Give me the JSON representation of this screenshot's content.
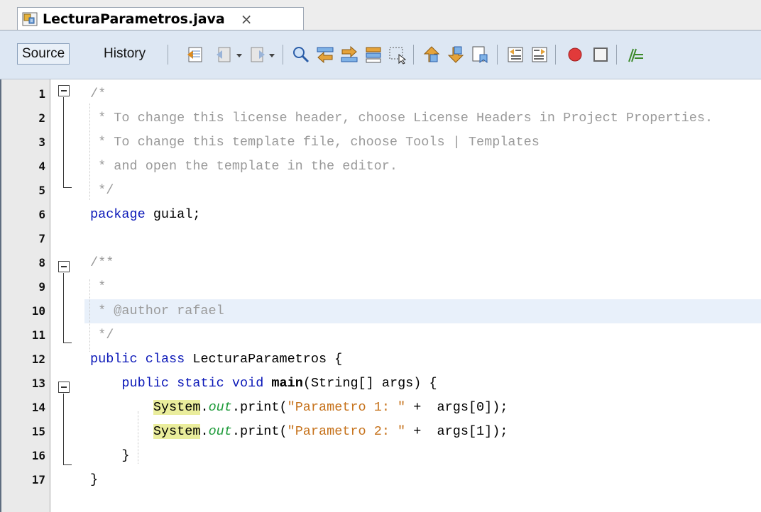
{
  "tab": {
    "title": "LecturaParametros.java",
    "close_glyph": "×"
  },
  "toolbar": {
    "source_label": "Source",
    "history_label": "History",
    "icons": [
      "last-edit-icon",
      "back-icon",
      "forward-icon",
      "find-selection-icon",
      "find-previous-icon",
      "find-next-icon",
      "toggle-highlight-icon",
      "toggle-rectangular-selection-icon",
      "previous-bookmark-icon",
      "next-bookmark-icon",
      "toggle-bookmark-icon",
      "shift-left-icon",
      "shift-right-icon",
      "start-macro-icon",
      "stop-macro-icon",
      "comment-icon"
    ]
  },
  "editor": {
    "lines": [
      {
        "n": "1",
        "tokens": [
          {
            "t": "/*",
            "c": "cm"
          }
        ]
      },
      {
        "n": "2",
        "tokens": [
          {
            "t": " * To change this license header, choose License Headers in Project Properties.",
            "c": "cm"
          }
        ]
      },
      {
        "n": "3",
        "tokens": [
          {
            "t": " * To change this template file, choose Tools | Templates",
            "c": "cm"
          }
        ]
      },
      {
        "n": "4",
        "tokens": [
          {
            "t": " * and open the template in the editor.",
            "c": "cm"
          }
        ]
      },
      {
        "n": "5",
        "tokens": [
          {
            "t": " */",
            "c": "cm"
          }
        ]
      },
      {
        "n": "6",
        "tokens": [
          {
            "t": "package",
            "c": "kw"
          },
          {
            "t": " guial;",
            "c": ""
          }
        ]
      },
      {
        "n": "7",
        "tokens": []
      },
      {
        "n": "8",
        "tokens": [
          {
            "t": "/**",
            "c": "cm"
          }
        ]
      },
      {
        "n": "9",
        "tokens": [
          {
            "t": " *",
            "c": "cm"
          }
        ]
      },
      {
        "n": "10",
        "tokens": [
          {
            "t": " * @author rafael",
            "c": "cm"
          }
        ],
        "highlight": true
      },
      {
        "n": "11",
        "tokens": [
          {
            "t": " */",
            "c": "cm"
          }
        ]
      },
      {
        "n": "12",
        "tokens": [
          {
            "t": "public",
            "c": "kw"
          },
          {
            "t": " ",
            "c": ""
          },
          {
            "t": "class",
            "c": "kw"
          },
          {
            "t": " LecturaParametros {",
            "c": ""
          }
        ]
      },
      {
        "n": "13",
        "tokens": [
          {
            "t": "    ",
            "c": ""
          },
          {
            "t": "public",
            "c": "kw"
          },
          {
            "t": " ",
            "c": ""
          },
          {
            "t": "static",
            "c": "kw"
          },
          {
            "t": " ",
            "c": ""
          },
          {
            "t": "void",
            "c": "kw"
          },
          {
            "t": " ",
            "c": ""
          },
          {
            "t": "main",
            "c": "mth"
          },
          {
            "t": "(String[] args) {",
            "c": ""
          }
        ]
      },
      {
        "n": "14",
        "tokens": [
          {
            "t": "        ",
            "c": ""
          },
          {
            "t": "System",
            "c": "mark"
          },
          {
            "t": ".",
            "c": ""
          },
          {
            "t": "out",
            "c": "fld"
          },
          {
            "t": ".print(",
            "c": ""
          },
          {
            "t": "\"Parametro 1: \"",
            "c": "str"
          },
          {
            "t": " +  args[0]);",
            "c": ""
          }
        ]
      },
      {
        "n": "15",
        "tokens": [
          {
            "t": "        ",
            "c": ""
          },
          {
            "t": "System",
            "c": "mark"
          },
          {
            "t": ".",
            "c": ""
          },
          {
            "t": "out",
            "c": "fld"
          },
          {
            "t": ".print(",
            "c": ""
          },
          {
            "t": "\"Parametro 2: \"",
            "c": "str"
          },
          {
            "t": " +  args[1]);",
            "c": ""
          }
        ]
      },
      {
        "n": "16",
        "tokens": [
          {
            "t": "    }",
            "c": ""
          }
        ]
      },
      {
        "n": "17",
        "tokens": [
          {
            "t": "}",
            "c": ""
          }
        ]
      }
    ]
  },
  "colors": {
    "keyword": "#0b18b8",
    "comment": "#9a9a9a",
    "string": "#c6721b",
    "static_field": "#1e9b3a",
    "mark_occurrence": "#eaed9c",
    "current_line": "#e8f0fa"
  }
}
